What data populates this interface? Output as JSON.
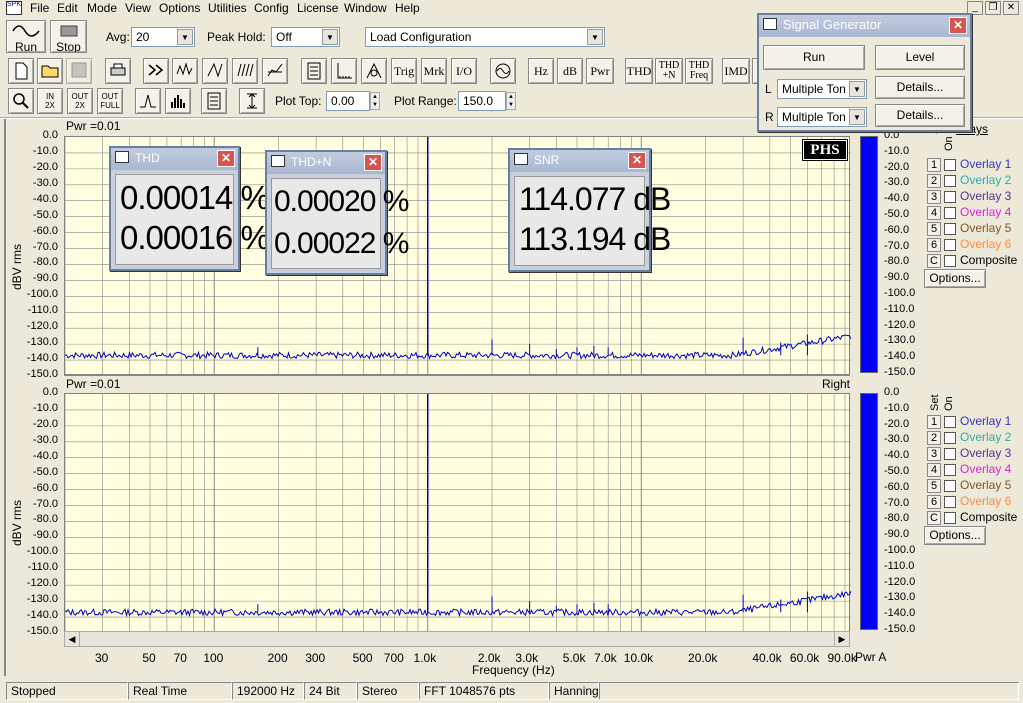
{
  "menu": [
    "File",
    "Edit",
    "Mode",
    "View",
    "Options",
    "Utilities",
    "Config",
    "License",
    "Window",
    "Help"
  ],
  "toolbar": {
    "run_label": "Run",
    "stop_label": "Stop",
    "avg_label": "Avg:",
    "avg_value": "20",
    "peak_hold_label": "Peak Hold:",
    "peak_hold_value": "Off",
    "load_config": "Load Configuration",
    "trig": "Trig",
    "mrk": "Mrk",
    "io": "I/O",
    "hz": "Hz",
    "db": "dB",
    "pwr": "Pwr",
    "thd": "THD",
    "thdn_top": "THD",
    "thdn_bottom": "+N",
    "thdf_top": "THD",
    "thdf_bottom": "Freq",
    "imd": "IMD",
    "in2x_top": "IN",
    "in2x_bottom": "2X",
    "out2x_top": "OUT",
    "out2x_bottom": "2X",
    "outfull_top": "OUT",
    "outfull_bottom": "FULL",
    "plot_top_label": "Plot Top:",
    "plot_top_value": "0.00",
    "plot_range_label": "Plot Range:",
    "plot_range_value": "150.0"
  },
  "top_plot": {
    "pwr": "Pwr =0.01",
    "channel": ""
  },
  "bottom_plot": {
    "pwr": "Pwr =0.01",
    "channel": "Right"
  },
  "y_axis_title": "dBV rms",
  "y_ticks": [
    "0.0",
    "-10.0",
    "-20.0",
    "-30.0",
    "-40.0",
    "-50.0",
    "-60.0",
    "-70.0",
    "-80.0",
    "-90.0",
    "-100.0",
    "-110.0",
    "-120.0",
    "-130.0",
    "-140.0",
    "-150.0"
  ],
  "x_axis_title": "Frequency (Hz)",
  "x_ticks": [
    "30",
    "50",
    "70",
    "100",
    "200",
    "300",
    "500",
    "700",
    "1.0k",
    "2.0k",
    "3.0k",
    "5.0k",
    "7.0k",
    "10.0k",
    "20.0k",
    "40.0k",
    "60.0k",
    "90.0k"
  ],
  "meter": {
    "pwr_label": "Pwr A",
    "level_fraction": 1.0
  },
  "overlays": {
    "set_label": "Set",
    "on_label": "On",
    "header": "erlays",
    "items": [
      {
        "num": "1",
        "label": "Overlay 1",
        "color": "#3333cc"
      },
      {
        "num": "2",
        "label": "Overlay 2",
        "color": "#33aaaa"
      },
      {
        "num": "3",
        "label": "Overlay 3",
        "color": "#553399"
      },
      {
        "num": "4",
        "label": "Overlay 4",
        "color": "#dd22dd"
      },
      {
        "num": "5",
        "label": "Overlay 5",
        "color": "#885522"
      },
      {
        "num": "6",
        "label": "Overlay 6",
        "color": "#ff8844"
      },
      {
        "num": "C",
        "label": "Composite",
        "color": "#000000"
      }
    ],
    "options_label": "Options..."
  },
  "signal_generator": {
    "title": "Signal Generator",
    "run": "Run",
    "level": "Level",
    "l_label": "L",
    "r_label": "R",
    "l_value": "Multiple Ton",
    "r_value": "Multiple Ton",
    "details": "Details..."
  },
  "thd_popup": {
    "title": "THD",
    "v1": "0.00014 %",
    "v2": "0.00016 %"
  },
  "thdn_popup": {
    "title": "THD+N",
    "v1": "0.00020 %",
    "v2": "0.00022 %"
  },
  "snr_popup": {
    "title": "SNR",
    "v1": "114.077 dB",
    "v2": "113.194 dB"
  },
  "logo": "PHS",
  "status": [
    "Stopped",
    "Real Time",
    "192000 Hz",
    "24 Bit",
    "Stereo",
    "FFT 1048576 pts",
    "Hanning"
  ],
  "colors": {
    "plot_bg": "#ffffe0",
    "trace": "#0000cc",
    "meter": "#0000ff",
    "grid": "#888888"
  }
}
